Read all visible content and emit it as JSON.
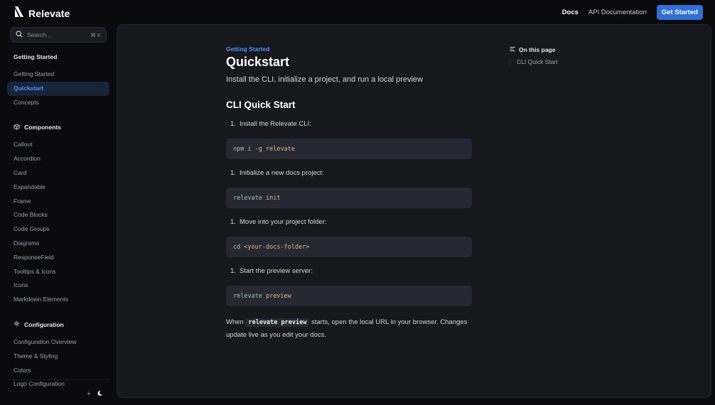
{
  "header": {
    "brand": "Relevate",
    "nav": [
      "Docs",
      "API Documentation"
    ],
    "cta": "Get Started"
  },
  "sidebar": {
    "search": {
      "placeholder": "Search...",
      "shortcut": "⌘ K"
    },
    "groups": [
      {
        "title": "Getting Started",
        "icon": "none",
        "items": [
          "Getting Started",
          "Quickstart",
          "Concepts"
        ]
      },
      {
        "title": "Components",
        "icon": "cube-icon",
        "items": [
          "Callout",
          "Accordion",
          "Card",
          "Expandable",
          "Frame",
          "Code Blocks",
          "Code Groups",
          "Diagrams",
          "ResponseField",
          "Tooltips & Icons",
          "Icons",
          "Markdown Elements"
        ]
      },
      {
        "title": "Configuration",
        "icon": "gear-icon",
        "items": [
          "Configuration Overview",
          "Theme & Styling",
          "Colors",
          "Logo Configuration"
        ]
      }
    ],
    "active_item": "Quickstart",
    "theme_toggle": {
      "options": [
        "sun-icon",
        "moon-icon"
      ],
      "selected": "moon-icon"
    }
  },
  "page": {
    "eyebrow": "Getting Started",
    "title": "Quickstart",
    "lead": "Install the CLI, initialize a project, and run a local preview",
    "section_title": "CLI Quick Start",
    "steps": [
      {
        "num": "1.",
        "text": "Install the Relevate CLI:",
        "code_cmd": "npm",
        "code_arg": "i -g relevate"
      },
      {
        "num": "1.",
        "text": "Initialize a new docs project:",
        "code_cmd": "relevate",
        "code_arg": "init"
      },
      {
        "num": "1.",
        "text": "Move into your project folder:",
        "code_cmd": "cd",
        "code_arg": "<your-docs-folder>"
      },
      {
        "num": "1.",
        "text": "Start the preview server:",
        "code_cmd": "relevate",
        "code_arg": "preview"
      }
    ],
    "closing": {
      "before": "When",
      "code": "relevate preview",
      "after": "starts, open the local URL in your browser. Changes update live as you edit your docs."
    }
  },
  "toc": {
    "title": "On this page",
    "items": [
      "CLI Quick Start"
    ]
  },
  "colors": {
    "accent": "#4d93f0",
    "button": "#2f6fd6",
    "background": "#0b0b0e",
    "panel": "#17181d",
    "code_bg": "#262833",
    "code_command": "#8fd0a6",
    "code_argument": "#e3b873"
  }
}
